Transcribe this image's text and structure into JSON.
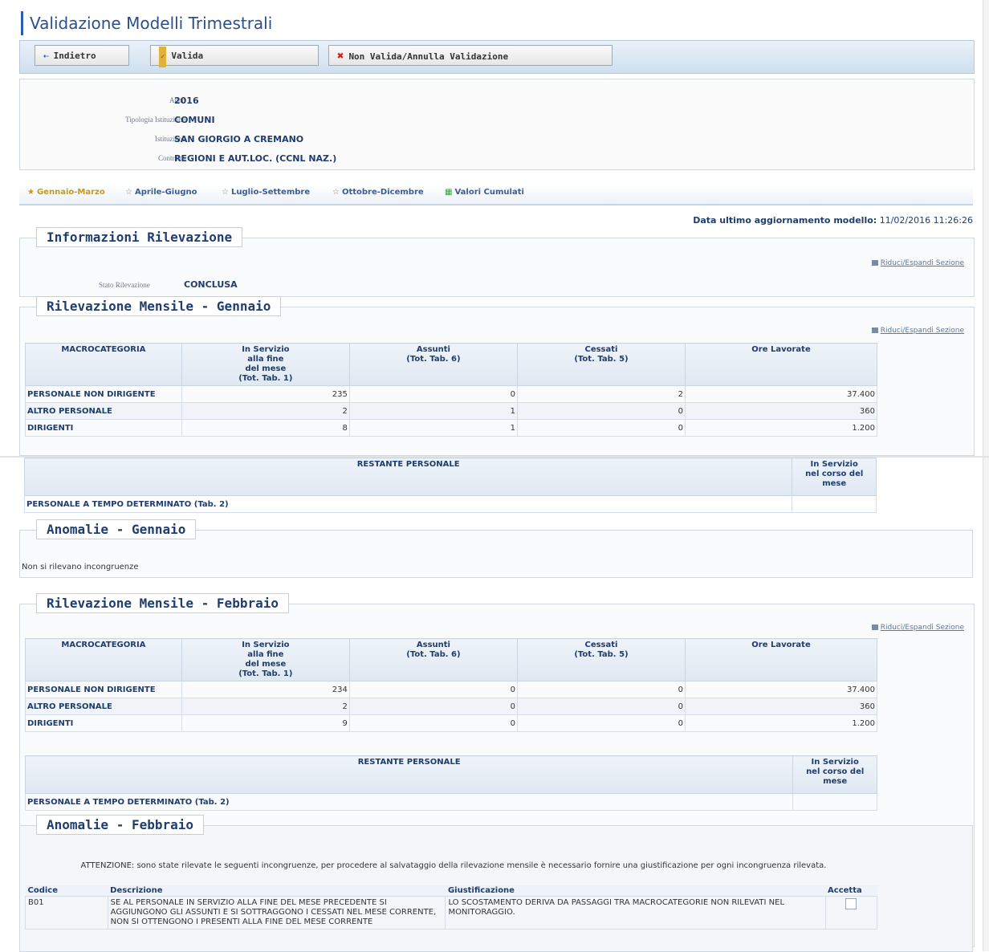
{
  "page": {
    "title": "Validazione Modelli Trimestrali"
  },
  "toolbar": {
    "back_label": "Indietro",
    "valid_label": "Valida",
    "invalid_label": "Non Valida/Annulla Validazione"
  },
  "info": {
    "anno_label": "Anno",
    "anno": "2016",
    "tipologia_label": "Tipologia Istituzione",
    "tipologia": "COMUNI",
    "istituzione_label": "Istituzione",
    "istituzione": "SAN GIORGIO A CREMANO",
    "contratto_label": "Contratto",
    "contratto": "REGIONI E AUT.LOC. (CCNL NAZ.)"
  },
  "tabs": [
    {
      "label": "Gennaio-Marzo",
      "icon": "star-icon"
    },
    {
      "label": "Aprile-Giugno",
      "icon": "star-icon"
    },
    {
      "label": "Luglio-Settembre",
      "icon": "star-icon"
    },
    {
      "label": "Ottobre-Dicembre",
      "icon": "star-icon"
    },
    {
      "label": "Valori Cumulati",
      "icon": "grid-icon"
    }
  ],
  "update": {
    "label": "Data ultimo aggiornamento modello:",
    "value": "11/02/2016 11:26:26"
  },
  "toggle_label": "Riduci/Espandi Sezione",
  "info_section": {
    "title": "Informazioni Rilevazione",
    "stato_label": "Stato Rilevazione",
    "stato": "CONCLUSA"
  },
  "headers": {
    "macro": "MACROCATEGORIA",
    "servizio": [
      "In Servizio",
      "alla fine",
      "del mese",
      "(Tot. Tab. 1)"
    ],
    "assunti": [
      "Assunti",
      "(Tot. Tab. 6)"
    ],
    "cessati": [
      "Cessati",
      "(Tot. Tab. 5)"
    ],
    "ore": "Ore Lavorate",
    "restante": "RESTANTE PERSONALE",
    "nel_corso": [
      "In Servizio",
      "nel corso del",
      "mese"
    ]
  },
  "row_labels": {
    "non_dirigente": "PERSONALE NON DIRIGENTE",
    "altro": "ALTRO PERSONALE",
    "dirigenti": "DIRIGENTI",
    "tempo_det": "PERSONALE A TEMPO DETERMINATO (Tab. 2)"
  },
  "gennaio": {
    "title": "Rilevazione Mensile - Gennaio",
    "rows": [
      {
        "servizio": "235",
        "assunti": "0",
        "cessati": "2",
        "ore": "37.400"
      },
      {
        "servizio": "2",
        "assunti": "1",
        "cessati": "0",
        "ore": "360"
      },
      {
        "servizio": "8",
        "assunti": "1",
        "cessati": "0",
        "ore": "1.200"
      }
    ],
    "anomalie_title": "Anomalie - Gennaio",
    "anomalie_text": "Non si rilevano incongruenze"
  },
  "febbraio": {
    "title": "Rilevazione Mensile - Febbraio",
    "rows": [
      {
        "servizio": "234",
        "assunti": "0",
        "cessati": "0",
        "ore": "37.400"
      },
      {
        "servizio": "2",
        "assunti": "0",
        "cessati": "0",
        "ore": "360"
      },
      {
        "servizio": "9",
        "assunti": "0",
        "cessati": "0",
        "ore": "1.200"
      }
    ],
    "anomalie_title": "Anomalie - Febbraio",
    "warning": "ATTENZIONE: sono state rilevate le seguenti incongruenze, per procedere al salvataggio della rilevazione mensile è necessario fornire una giustificazione per ogni incongruenza rilevata.",
    "anom_headers": {
      "codice": "Codice",
      "descrizione": "Descrizione",
      "giustificazione": "Giustificazione",
      "accetta": "Accetta"
    },
    "anomalie": [
      {
        "codice": "B01",
        "descrizione": "SE AL PERSONALE IN SERVIZIO ALLA FINE DEL MESE PRECEDENTE SI AGGIUNGONO GLI ASSUNTI E SI SOTTRAGGONO I CESSATI NEL MESE CORRENTE, NON SI OTTENGONO I PRESENTI ALLA FINE DEL MESE CORRENTE",
        "giustificazione": "LO SCOSTAMENTO DERIVA DA PASSAGGI TRA MACROCATEGORIE NON RILEVATI NEL MONITORAGGIO."
      }
    ]
  },
  "colors": {
    "accent": "#2a5db0",
    "title_text": "#1f3d6e",
    "active_tab": "#c89a12"
  }
}
